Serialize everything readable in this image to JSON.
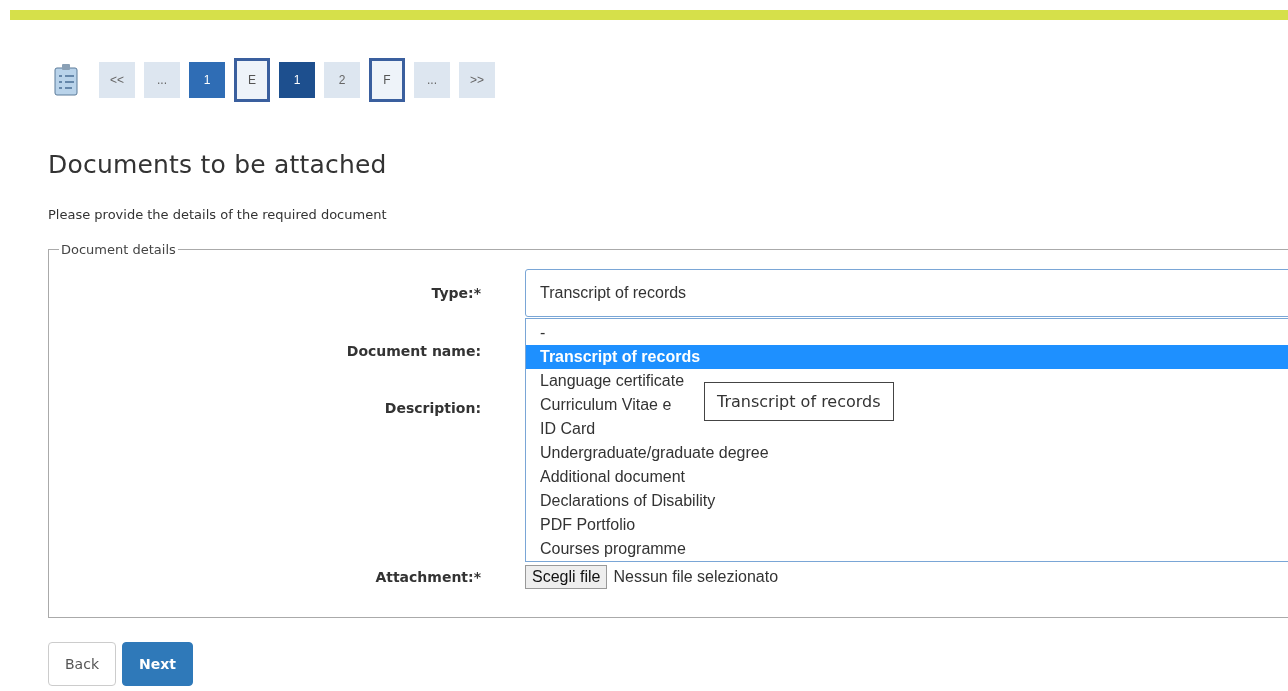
{
  "steps": [
    {
      "label": "<<",
      "kind": "link"
    },
    {
      "label": "...",
      "kind": "link"
    },
    {
      "label": "1",
      "kind": "done"
    },
    {
      "label": "E",
      "kind": "section"
    },
    {
      "label": "1",
      "kind": "current"
    },
    {
      "label": "2",
      "kind": "link"
    },
    {
      "label": "F",
      "kind": "section"
    },
    {
      "label": "...",
      "kind": "link"
    },
    {
      "label": ">>",
      "kind": "link"
    }
  ],
  "heading": "Documents to be attached",
  "instruction": "Please provide the details of the required document",
  "fieldset": {
    "legend": "Document details",
    "fields": [
      {
        "label": "Type:*",
        "kind": "select",
        "value": "Transcript of records"
      },
      {
        "label": "Document name:"
      },
      {
        "label": "Description:"
      },
      {
        "label": "Attachment:*",
        "kind": "file",
        "button": "Scegli file",
        "status": "Nessun file selezionato"
      }
    ]
  },
  "dropdown": {
    "options": [
      {
        "label": "-",
        "selected": false
      },
      {
        "label": "Transcript of records",
        "selected": true
      },
      {
        "label": "Language certificate",
        "selected": false
      },
      {
        "label": "Curriculum Vitae e",
        "selected": false
      },
      {
        "label": "ID Card",
        "selected": false
      },
      {
        "label": "Undergraduate/graduate degree",
        "selected": false
      },
      {
        "label": "Additional document",
        "selected": false
      },
      {
        "label": "Declarations of Disability",
        "selected": false
      },
      {
        "label": "PDF Portfolio",
        "selected": false
      },
      {
        "label": "Courses programme",
        "selected": false
      }
    ]
  },
  "tooltip": "Transcript of records",
  "buttons": [
    {
      "label": "Back",
      "kind": "secondary"
    },
    {
      "label": "Next",
      "kind": "primary"
    }
  ]
}
